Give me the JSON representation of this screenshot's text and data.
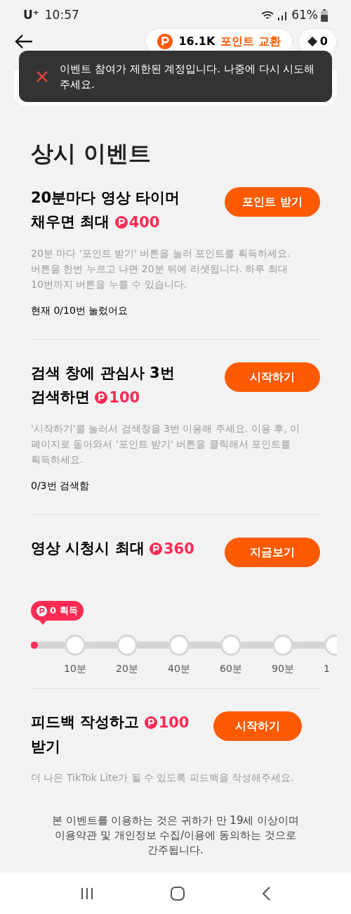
{
  "status_bar": {
    "carrier": "U⁺",
    "time": "10:57",
    "battery": "61%"
  },
  "header": {
    "points": "16.1K",
    "exchange": "포인트 교환",
    "count": "0"
  },
  "toast": {
    "message": "이벤트 참여가 제한된 계정입니다. 나중에 다시 시도해 주세요."
  },
  "section_title": "상시 이벤트",
  "events": [
    {
      "kind": "timer",
      "title": "20분마다 영상 타이머 채우면 최대",
      "points": "400",
      "button": "포인트 받기",
      "description": "20분 마다 '포인트 받기' 버튼을 눌러 포인트를 획득하세요. 버튼을 한번 누르고 나면 20분 뒤에 리셋됩니다. 하루 최대 10번까지 버튼을 누를 수 있습니다.",
      "status": "현재 0/10번 눌렀어요"
    },
    {
      "kind": "search",
      "title": "검색 창에 관심사  3번 검색하면",
      "points": "100",
      "button": "시작하기",
      "description": "'시작하기'를 눌러서 검색창을 3번 이용해 주세요. 이용 후, 이 페이지로 돌아와서 '포인트 받기' 버튼을 클릭해서 포인트를 획득하세요.",
      "status": "0/3번 검색함"
    },
    {
      "kind": "watch",
      "title": "영상 시청시 최대",
      "points": "360",
      "button": "지금보기",
      "progress": {
        "badge": "0 획득",
        "level": 0,
        "milestones": [
          "10분",
          "20분",
          "40분",
          "60분",
          "90분",
          "1"
        ]
      }
    },
    {
      "kind": "feedback",
      "title": "피드백 작성하고",
      "points": "100",
      "title_suffix": "받기",
      "button": "시작하기",
      "description": "더 나은 TikTok Lite가 될 수 있도록 피드백을 작성해주세요."
    }
  ],
  "footer_note": "본 이벤트를 이용하는 것은 귀하가 만 19세 이상이며 이용약관 및 개인정보 수집/이용에 동의하는 것으로 간주됩니다."
}
